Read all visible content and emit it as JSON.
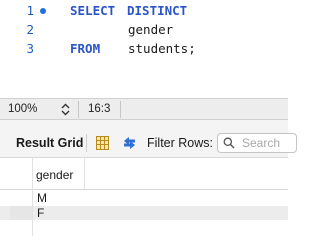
{
  "editor": {
    "lines": [
      {
        "number": "1",
        "keyword": "SELECT",
        "keyword2": "DISTINCT"
      },
      {
        "number": "2",
        "text": "gender"
      },
      {
        "number": "3",
        "keyword": "FROM",
        "text": "students;"
      }
    ]
  },
  "statusbar": {
    "zoom": "100%",
    "position": "16:3"
  },
  "result_toolbar": {
    "title": "Result Grid",
    "filter_label": "Filter Rows:",
    "search_placeholder": "Search"
  },
  "grid": {
    "columns": [
      "gender"
    ],
    "rows": [
      [
        "M"
      ],
      [
        "F"
      ]
    ]
  },
  "colors": {
    "keyword": "#2a54c8",
    "line_number": "#1f5fbf",
    "breakpoint": "#1f6fe0",
    "refresh_icon": "#2f6fd6"
  }
}
